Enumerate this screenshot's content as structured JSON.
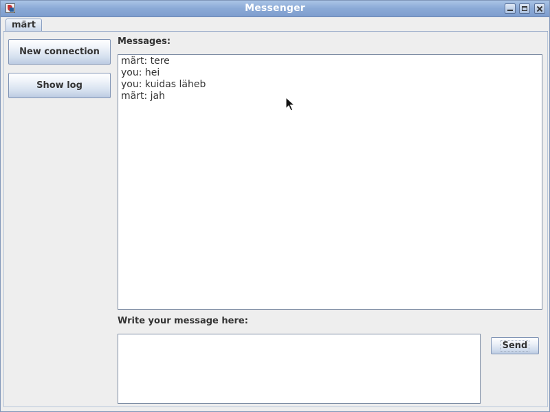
{
  "window": {
    "title": "Messenger"
  },
  "tabs": [
    {
      "label": "märt",
      "selected": true
    }
  ],
  "sidebar": {
    "new_connection_label": "New connection",
    "show_log_label": "Show log"
  },
  "messages": {
    "label": "Messages:",
    "lines": [
      "märt: tere",
      "you: hei",
      "you: kuidas läheb",
      "märt: jah"
    ]
  },
  "compose": {
    "label": "Write your message here:",
    "value": "",
    "send_label": "Send"
  },
  "icons": {
    "app": "java-app-icon",
    "minimize": "minimize-icon",
    "maximize": "maximize-icon",
    "close": "close-icon",
    "cursor": "mouse-pointer-icon"
  },
  "colors": {
    "titlebar": "#8aa9d6",
    "window_bg": "#eeeeee",
    "text": "#333333"
  }
}
